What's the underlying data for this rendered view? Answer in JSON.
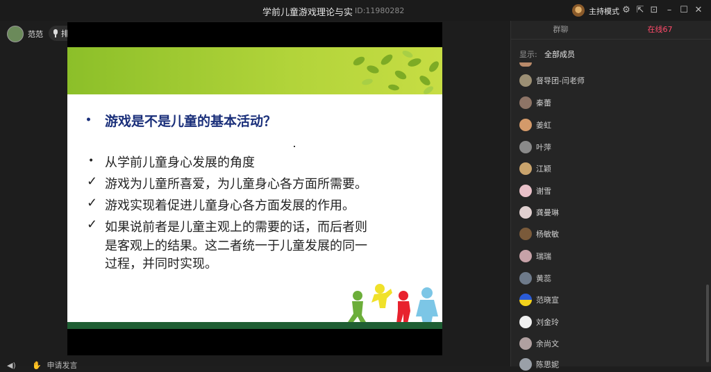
{
  "window": {
    "title": "学前儿童游戏理论与实",
    "room_id": "ID:11980282",
    "host_mode": "主持模式"
  },
  "presenter": {
    "name": "范范",
    "mic_label": "排麦"
  },
  "slide": {
    "heading": "游戏是不是儿童的基本活动？",
    "lines": [
      "从学前儿童身心发展的角度",
      "游戏为儿童所喜爱，为儿童身心各方面所需要。",
      "游戏实现着促进儿童身心各方面发展的作用。",
      "如果说前者是儿童主观上的需要的话，而后者则",
      "是客观上的结果。这二者统一于儿童发展的同一",
      "过程，并同时实现。"
    ],
    "accent_color": "#8cbf29"
  },
  "bottom": {
    "apply_speak": "申请发言"
  },
  "panel": {
    "tabs": [
      "群聊",
      "在线67"
    ],
    "filter_label": "显示:",
    "filter_value": "全部成员",
    "members": [
      "督导团-闫老师",
      "秦蕾",
      "姜虹",
      "叶萍",
      "江颖",
      "谢雪",
      "龚曼琳",
      "杨敏敏",
      "瑞瑞",
      "黄蕊",
      "范晓宣",
      "刘金玲",
      "余尚文",
      "陈思妮"
    ],
    "active_color": "#ff4a6a"
  }
}
